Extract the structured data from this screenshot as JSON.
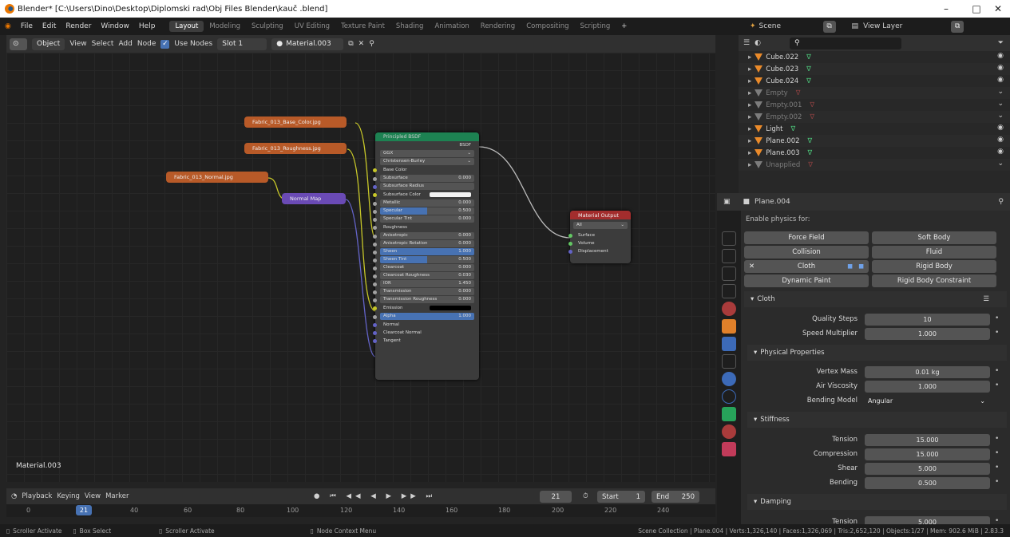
{
  "window": {
    "title": "Blender* [C:\\Users\\Dino\\Desktop\\Diplomski rad\\Obj Files Blender\\kauč .blend]",
    "minimize": "–",
    "maximize": "□",
    "close": "✕"
  },
  "menu": [
    "File",
    "Edit",
    "Render",
    "Window",
    "Help"
  ],
  "workspaces": [
    "Layout",
    "Modeling",
    "Sculpting",
    "UV Editing",
    "Texture Paint",
    "Shading",
    "Animation",
    "Rendering",
    "Compositing",
    "Scripting"
  ],
  "workspace_add": "+",
  "scene": {
    "scene_name": "Scene",
    "view_layer": "View Layer"
  },
  "node_header": {
    "mode": "Object",
    "view": "View",
    "select": "Select",
    "add": "Add",
    "node": "Node",
    "use_nodes": "Use Nodes",
    "slot": "Slot 1",
    "material": "Material.003"
  },
  "nodes": {
    "img1": "Fabric_013_Base_Color.jpg",
    "img2": "Fabric_013_Roughness.jpg",
    "img3": "Fabric_013_Normal.jpg",
    "normal_map": "Normal Map",
    "bsdf": {
      "title": "Principled BSDF",
      "out": "BSDF",
      "distribution": "GGX",
      "subsurface_method": "Christensen-Burley",
      "rows": [
        {
          "label": "Base Color",
          "value": "",
          "kind": "plain",
          "dot": "dy"
        },
        {
          "label": "Subsurface",
          "value": "0.000",
          "kind": "sl",
          "dot": "dg"
        },
        {
          "label": "Subsurface Radius",
          "value": "",
          "kind": "sl",
          "dot": "dp"
        },
        {
          "label": "Subsurface Color",
          "value": "",
          "kind": "plain",
          "dot": "dy"
        },
        {
          "label": "Metallic",
          "value": "0.000",
          "kind": "sl",
          "dot": "dg"
        },
        {
          "label": "Specular",
          "value": "0.500",
          "kind": "bl",
          "dot": "dg"
        },
        {
          "label": "Specular Tint",
          "value": "0.000",
          "kind": "sl",
          "dot": "dg"
        },
        {
          "label": "Roughness",
          "value": "",
          "kind": "plain",
          "dot": "dg"
        },
        {
          "label": "Anisotropic",
          "value": "0.000",
          "kind": "sl",
          "dot": "dg"
        },
        {
          "label": "Anisotropic Rotation",
          "value": "0.000",
          "kind": "sl",
          "dot": "dg"
        },
        {
          "label": "Sheen",
          "value": "1.000",
          "kind": "fb",
          "dot": "dg"
        },
        {
          "label": "Sheen Tint",
          "value": "0.500",
          "kind": "bl",
          "dot": "dg"
        },
        {
          "label": "Clearcoat",
          "value": "0.000",
          "kind": "sl",
          "dot": "dg"
        },
        {
          "label": "Clearcoat Roughness",
          "value": "0.030",
          "kind": "sl",
          "dot": "dg"
        },
        {
          "label": "IOR",
          "value": "1.450",
          "kind": "sl",
          "dot": "dg"
        },
        {
          "label": "Transmission",
          "value": "0.000",
          "kind": "sl",
          "dot": "dg"
        },
        {
          "label": "Transmission Roughness",
          "value": "0.000",
          "kind": "sl",
          "dot": "dg"
        },
        {
          "label": "Emission",
          "value": "",
          "kind": "plain",
          "dot": "dy"
        },
        {
          "label": "Alpha",
          "value": "1.000",
          "kind": "fb",
          "dot": "dg"
        },
        {
          "label": "Normal",
          "value": "",
          "kind": "plain",
          "dot": "dp"
        },
        {
          "label": "Clearcoat Normal",
          "value": "",
          "kind": "plain",
          "dot": "dp"
        },
        {
          "label": "Tangent",
          "value": "",
          "kind": "plain",
          "dot": "dp"
        }
      ]
    },
    "output": {
      "title": "Material Output",
      "target": "All",
      "sockets": [
        "Surface",
        "Volume",
        "Displacement"
      ]
    },
    "material_label": "Material.003"
  },
  "timeline": {
    "playback": "Playback",
    "keying": "Keying",
    "view": "View",
    "marker": "Marker",
    "current_frame": "21",
    "start_label": "Start",
    "start": "1",
    "end_label": "End",
    "end": "250",
    "ticks": [
      "0",
      "21",
      "40",
      "60",
      "80",
      "100",
      "120",
      "140",
      "160",
      "180",
      "200",
      "220",
      "240"
    ]
  },
  "status": {
    "left1": "Scroller Activate",
    "left2": "Box Select",
    "left3": "Scroller Activate",
    "mid": "Node Context Menu",
    "right": "Scene Collection | Plane.004 | Verts:1,326,140 | Faces:1,326,069 | Tris:2,652,120 | Objects:1/27 | Mem: 902.6 MiB | 2.83.3"
  },
  "outliner": [
    {
      "name": "Cube.022",
      "muted": false
    },
    {
      "name": "Cube.023",
      "muted": false
    },
    {
      "name": "Cube.024",
      "muted": false
    },
    {
      "name": "Empty",
      "muted": true
    },
    {
      "name": "Empty.001",
      "muted": true
    },
    {
      "name": "Empty.002",
      "muted": true
    },
    {
      "name": "Light",
      "muted": false
    },
    {
      "name": "Plane.002",
      "muted": false
    },
    {
      "name": "Plane.003",
      "muted": false
    },
    {
      "name": "Unapplied",
      "muted": true
    }
  ],
  "properties": {
    "object": "Plane.004",
    "enable_physics": "Enable physics for:",
    "buttons": [
      "Force Field",
      "Soft Body",
      "Collision",
      "Fluid",
      "Cloth",
      "Rigid Body",
      "Dynamic Paint",
      "Rigid Body Constraint"
    ],
    "cloth": "Cloth",
    "quality_steps_label": "Quality Steps",
    "quality_steps": "10",
    "speed_multiplier_label": "Speed Multiplier",
    "speed_multiplier": "1.000",
    "physical": "Physical Properties",
    "vertex_mass_label": "Vertex Mass",
    "vertex_mass": "0.01 kg",
    "air_viscosity_label": "Air Viscosity",
    "air_viscosity": "1.000",
    "bending_model_label": "Bending Model",
    "bending_model": "Angular",
    "stiffness": "Stiffness",
    "tension_label": "Tension",
    "tension": "15.000",
    "compression_label": "Compression",
    "compression": "15.000",
    "shear_label": "Shear",
    "shear": "5.000",
    "bending_label": "Bending",
    "bending": "0.500",
    "damping": "Damping",
    "d_tension_label": "Tension",
    "d_tension": "5.000"
  },
  "colors": {
    "accent": "#4772b3",
    "image_node": "#b85a28",
    "vector_node": "#6a4ab5",
    "shader_node": "#1d8252",
    "output_node": "#a32d2d"
  }
}
